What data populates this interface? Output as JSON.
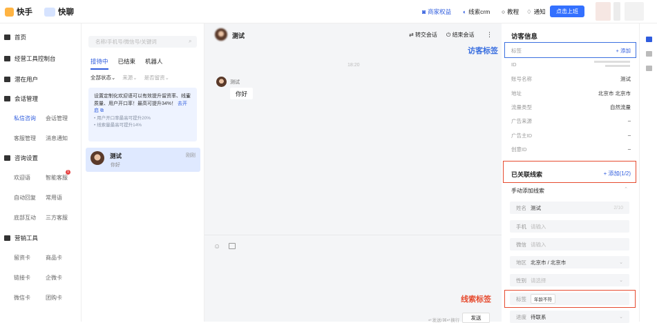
{
  "topbar": {
    "logo_kuaishou": "快手",
    "logo_kuailiao": "快聊",
    "nav": [
      {
        "label": "商家权益",
        "color": "#2f5cde"
      },
      {
        "label": "线索crm",
        "color": "#222"
      },
      {
        "label": "教程",
        "color": "#222"
      },
      {
        "label": "通知",
        "color": "#222"
      }
    ],
    "cta_label": "点击上班"
  },
  "sidebar": {
    "groups": [
      {
        "label": "首页"
      },
      {
        "label": "经营工具控制台"
      },
      {
        "label": "潜在用户"
      },
      {
        "label": "会话管理"
      },
      {
        "label": "咨询设置"
      },
      {
        "label": "营销工具"
      }
    ],
    "items": [
      {
        "label": "私信咨询",
        "active": true
      },
      {
        "label": "会话管理"
      },
      {
        "label": "客服管理"
      },
      {
        "label": "消息通知"
      },
      {
        "label": "欢迎语"
      },
      {
        "label": "智能客服",
        "badge": "1"
      },
      {
        "label": "自动回复"
      },
      {
        "label": "常用语"
      },
      {
        "label": "底部互动"
      },
      {
        "label": "三方客服"
      },
      {
        "label": "留资卡"
      },
      {
        "label": "商品卡"
      },
      {
        "label": "链接卡"
      },
      {
        "label": "企微卡"
      },
      {
        "label": "微信卡"
      },
      {
        "label": "团购卡"
      }
    ]
  },
  "list": {
    "search_placeholder": "名称/手机号/微信号/关键词",
    "tabs": [
      "接待中",
      "已结束",
      "机器人"
    ],
    "filters": [
      "全部状态⌄",
      "来源⌄",
      "是否留资⌄"
    ],
    "tip": {
      "text": "设置定制化欢迎语可以有效提升留资率、线索质量、用户开口率！最高可提升34%！",
      "link": "去开启",
      "close": "×",
      "bullets": [
        "• 用户开口率最高可提升20%",
        "• 线索量最高可提升14%"
      ]
    },
    "conversation": {
      "name": "测试",
      "time": "刚刚",
      "preview": "你好"
    }
  },
  "chat": {
    "title": "测试",
    "transfer": "转交会话",
    "end": "结束会话",
    "more": "⋮",
    "timestamp": "18:20",
    "sender": "测试",
    "message": "你好",
    "send_hint": "↵发送/⌘↵换行",
    "send_label": "发送"
  },
  "visitor": {
    "title": "访客信息",
    "tag_label": "标签",
    "tag_add": "+ 添加",
    "fields": [
      {
        "label": "ID",
        "value": ""
      },
      {
        "label": "账号名称",
        "value": "测试"
      },
      {
        "label": "地址",
        "value": "北京市 北京市"
      },
      {
        "label": "流量类型",
        "value": "自然流量"
      },
      {
        "label": "广告来源",
        "value": "–"
      },
      {
        "label": "广告主ID",
        "value": "–"
      },
      {
        "label": "创意ID",
        "value": "–"
      }
    ]
  },
  "clues": {
    "title": "已关联线索",
    "add": "+ 添加(1/2)",
    "section": "手动添加线索",
    "fields": [
      {
        "label": "姓名",
        "value": "测试",
        "extra": "2/10"
      },
      {
        "label": "手机",
        "placeholder": "请输入"
      },
      {
        "label": "微信",
        "placeholder": "请输入"
      },
      {
        "label": "地区",
        "value": "北京市 / 北京市",
        "chevron": "⌄"
      },
      {
        "label": "性别",
        "placeholder": "请选择",
        "chevron": "⌄"
      },
      {
        "label": "标签",
        "chip": "年龄不符"
      },
      {
        "label": "进度",
        "value": "待联系",
        "chevron": "⌄"
      }
    ]
  },
  "annotations": {
    "visitor_tag": "访客标签",
    "clue_tag": "线索标签"
  },
  "colors": {
    "accent": "#2f5cde",
    "annotation_red": "#e64a2e",
    "annotation_blue": "#3a6fe0"
  }
}
